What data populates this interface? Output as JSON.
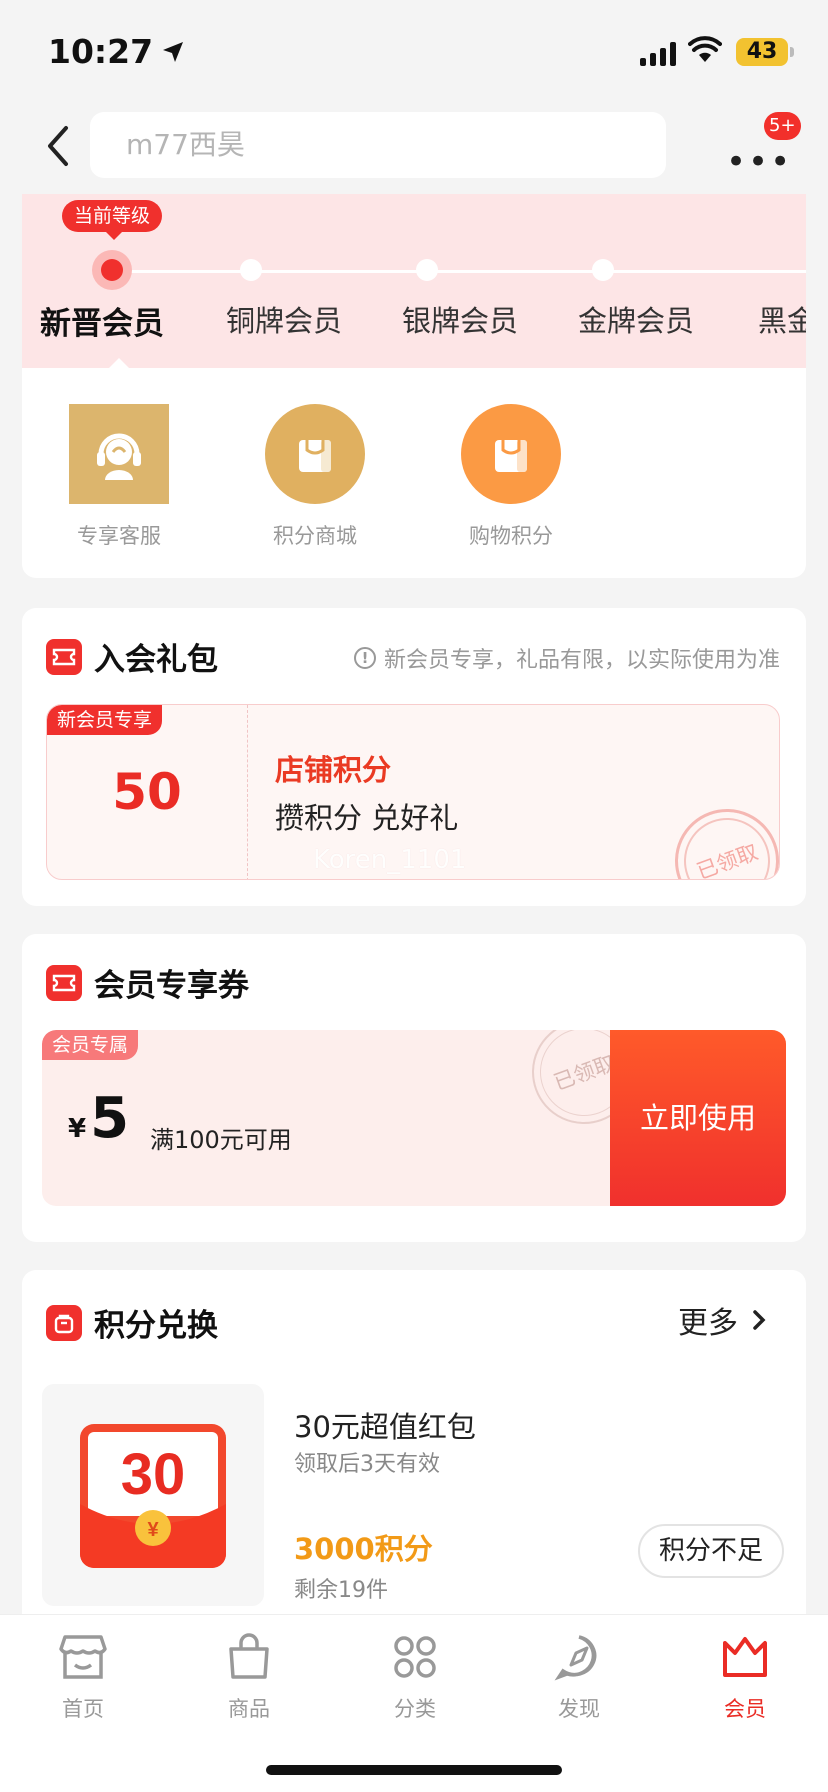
{
  "status_bar": {
    "time": "10:27",
    "battery": "43"
  },
  "header": {
    "search_placeholder": "m77西昊",
    "more_label": "•••",
    "more_badge": "5+"
  },
  "levels": {
    "current_tag": "当前等级",
    "items": [
      {
        "label": "新晋会员",
        "active": true
      },
      {
        "label": "铜牌会员",
        "active": false
      },
      {
        "label": "银牌会员",
        "active": false
      },
      {
        "label": "金牌会员",
        "active": false
      },
      {
        "label": "黑金",
        "active": false
      }
    ]
  },
  "benefits": [
    {
      "label": "专享客服",
      "icon": "headset-icon"
    },
    {
      "label": "积分商城",
      "icon": "shopping-bag-icon"
    },
    {
      "label": "购物积分",
      "icon": "shopping-bag-icon"
    }
  ],
  "gift_pack": {
    "title": "入会礼包",
    "note": "新会员专享，礼品有限，以实际使用为准",
    "tag": "新会员专享",
    "value": "50",
    "name": "店铺积分",
    "desc": "攒积分 兑好礼",
    "watermark": "Koren_1101",
    "stamp": "已领取"
  },
  "coupon": {
    "title": "会员专享券",
    "tag": "会员专属",
    "currency": "¥",
    "amount": "5",
    "condition": "满100元可用",
    "stamp": "已领取",
    "button": "立即使用"
  },
  "exchange": {
    "title": "积分兑换",
    "more": "更多",
    "item": {
      "image_value": "30",
      "image_currency": "¥",
      "name": "30元超值红包",
      "validity": "领取后3天有效",
      "points": "3000积分",
      "remaining": "剩余19件",
      "button": "积分不足"
    }
  },
  "tabbar": [
    {
      "label": "首页",
      "icon": "store-icon",
      "active": false
    },
    {
      "label": "商品",
      "icon": "bag-icon",
      "active": false
    },
    {
      "label": "分类",
      "icon": "grid-icon",
      "active": false
    },
    {
      "label": "发现",
      "icon": "compass-icon",
      "active": false
    },
    {
      "label": "会员",
      "icon": "crown-icon",
      "active": true
    }
  ],
  "colors": {
    "accent": "#f0302d",
    "level_bg": "#fde5e6",
    "points": "#f29a17"
  }
}
